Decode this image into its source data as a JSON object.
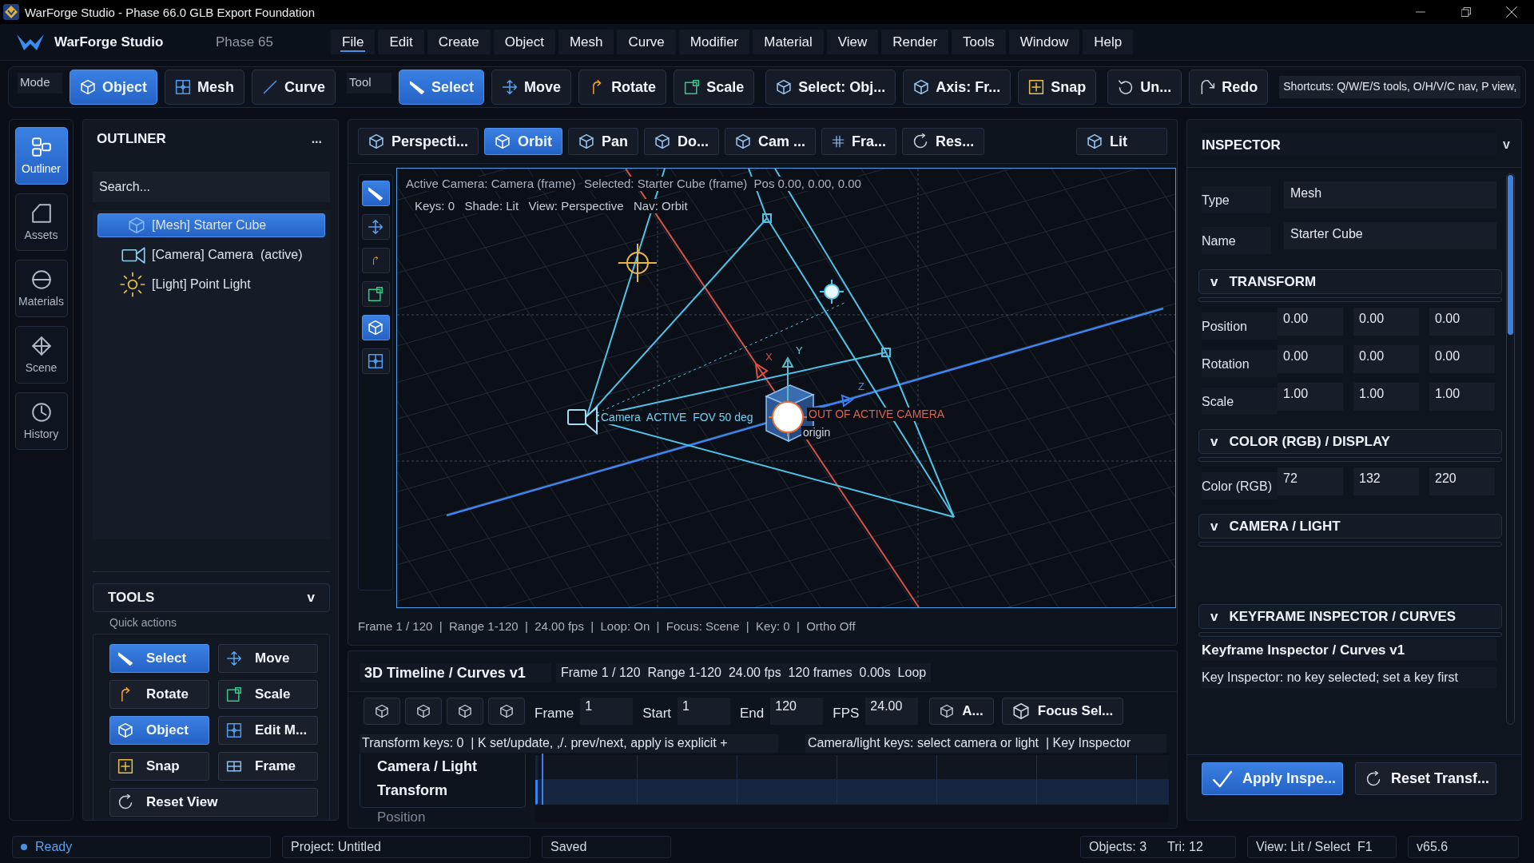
{
  "window": {
    "title": "WarForge Studio - Phase 66.0 GLB Export Foundation"
  },
  "app_bar": {
    "brand": "WarForge Studio",
    "phase": "Phase 65",
    "menus": [
      {
        "label": "File",
        "selected": true
      },
      {
        "label": "Edit",
        "selected": false
      },
      {
        "label": "Create",
        "selected": false
      },
      {
        "label": "Object",
        "selected": false
      },
      {
        "label": "Mesh",
        "selected": false
      },
      {
        "label": "Curve",
        "selected": false
      },
      {
        "label": "Modifier",
        "selected": false
      },
      {
        "label": "Material",
        "selected": false
      },
      {
        "label": "View",
        "selected": false
      },
      {
        "label": "Render",
        "selected": false
      },
      {
        "label": "Tools",
        "selected": false
      },
      {
        "label": "Window",
        "selected": false
      },
      {
        "label": "Help",
        "selected": false
      }
    ]
  },
  "toolbar": {
    "groups": [
      {
        "items": [
          {
            "kind": "label",
            "label": "Mode"
          },
          {
            "kind": "button",
            "label": "Object",
            "selected": true
          },
          {
            "kind": "button",
            "label": "Mesh",
            "selected": false
          },
          {
            "kind": "button",
            "label": "Curve",
            "selected": false
          }
        ]
      },
      {
        "items": [
          {
            "kind": "label",
            "label": "Tool"
          },
          {
            "kind": "button",
            "label": "Select",
            "selected": true
          },
          {
            "kind": "button",
            "label": "Move",
            "selected": false
          },
          {
            "kind": "button",
            "label": "Rotate",
            "selected": false
          },
          {
            "kind": "button",
            "label": "Scale",
            "selected": false
          }
        ]
      },
      {
        "items": [
          {
            "kind": "button",
            "label": "Select: Obj...",
            "selected": false
          },
          {
            "kind": "button",
            "label": "Axis: Fr...",
            "selected": false
          },
          {
            "kind": "button",
            "label": "Snap",
            "selected": false
          }
        ]
      },
      {
        "items": [
          {
            "kind": "button",
            "label": "Un...",
            "selected": false
          },
          {
            "kind": "button",
            "label": "Redo",
            "selected": false
          }
        ]
      }
    ],
    "shortcuts": "Shortcuts: Q/W/E/S tools, O/H/V/C nav, P view,"
  },
  "sidebar": {
    "items": [
      {
        "label": "Outliner",
        "selected": true
      },
      {
        "label": "Assets",
        "selected": false
      },
      {
        "label": "Materials",
        "selected": false
      },
      {
        "label": "Scene",
        "selected": false
      },
      {
        "label": "History",
        "selected": false
      }
    ]
  },
  "outliner": {
    "title": "OUTLINER",
    "menu": "...",
    "search": {
      "placeholder": "Search..."
    },
    "items": [
      {
        "kind": "mesh",
        "label": "[Mesh] Starter Cube",
        "selected": true
      },
      {
        "kind": "camera",
        "label": "[Camera] Camera  (active)",
        "selected": false
      },
      {
        "kind": "light",
        "label": "[Light] Point Light",
        "selected": false
      }
    ]
  },
  "tools": {
    "title": "TOOLS",
    "toggle": "v",
    "subtitle": "Quick actions",
    "buttons": [
      {
        "label": "Select",
        "selected": true
      },
      {
        "label": "Move",
        "selected": false
      },
      {
        "label": "Rotate",
        "selected": false
      },
      {
        "label": "Scale",
        "selected": false
      },
      {
        "label": "Object",
        "selected": true
      },
      {
        "label": "Edit M...",
        "selected": false
      },
      {
        "label": "Snap",
        "selected": false
      },
      {
        "label": "Frame",
        "selected": false
      },
      {
        "label": "Reset View",
        "selected": false
      }
    ]
  },
  "viewport": {
    "toolbar": [
      {
        "label": "Perspecti...",
        "selected": false
      },
      {
        "label": "Orbit",
        "selected": true
      },
      {
        "label": "Pan",
        "selected": false
      },
      {
        "label": "Do...",
        "selected": false
      },
      {
        "label": "Cam ...",
        "selected": false
      },
      {
        "label": "Fra...",
        "selected": false
      },
      {
        "label": "Res...",
        "selected": false
      }
    ],
    "shading": {
      "label": "Lit",
      "selected": false
    },
    "side_tools": [
      {
        "selected": true
      },
      {
        "selected": false
      },
      {
        "selected": false
      },
      {
        "selected": false
      },
      {
        "selected": true
      },
      {
        "selected": false
      }
    ],
    "overlay": {
      "active_camera": "Active Camera: Camera (frame)",
      "selection": "Selected: Starter Cube (frame)  Pos 0.00, 0.00, 0.00",
      "info": "Keys: 0   Shade: Lit   View: Perspective   Nav: Orbit"
    },
    "labels": {
      "camera": "Camera  ACTIVE  FOV 50 deg",
      "warning": "OUT OF ACTIVE CAMERA",
      "origin": "origin",
      "x_axis": "X",
      "y_axis": "Y",
      "z_axis": "Z"
    },
    "status": "Frame 1 / 120  |  Range 1-120  |  24.00 fps  |  Loop: On  |  Focus: Scene  |  Key: 0  |  Ortho Off"
  },
  "timeline": {
    "title": "3D Timeline / Curves v1",
    "summary": "Frame 1 / 120  Range 1-120  24.00 fps  120 frames  0.00s  Loop",
    "fields": [
      {
        "label": "Frame",
        "value": "1"
      },
      {
        "label": "Start",
        "value": "1"
      },
      {
        "label": "End",
        "value": "120"
      },
      {
        "label": "FPS",
        "value": "24.00"
      }
    ],
    "buttons": [
      "A...",
      "Focus Sel..."
    ],
    "info": [
      "Transform keys: 0  | K set/update, ,/. prev/next, apply is explicit +",
      "Camera/light keys: select camera or light  | Key Inspector"
    ],
    "tracks": [
      {
        "label": "Camera / Light",
        "selected": false
      },
      {
        "label": "Transform",
        "selected": true
      }
    ],
    "subtrack": "Position"
  },
  "inspector": {
    "title": "INSPECTOR",
    "toggle": "v",
    "fields": [
      {
        "label": "Type",
        "value": "Mesh"
      },
      {
        "label": "Name",
        "value": "Starter Cube"
      }
    ],
    "sections": [
      {
        "kind": "vectors",
        "toggle": "v",
        "title": "TRANSFORM",
        "rows": [
          {
            "label": "Position",
            "values": [
              "0.00",
              "0.00",
              "0.00"
            ]
          },
          {
            "label": "Rotation",
            "values": [
              "0.00",
              "0.00",
              "0.00"
            ]
          },
          {
            "label": "Scale",
            "values": [
              "1.00",
              "1.00",
              "1.00"
            ]
          }
        ]
      },
      {
        "kind": "vectors",
        "toggle": "v",
        "title": "COLOR (RGB) / DISPLAY",
        "rows": [
          {
            "label": "Color (RGB)",
            "values": [
              "72",
              "132",
              "220"
            ]
          }
        ]
      },
      {
        "kind": "empty",
        "toggle": "v",
        "title": "CAMERA / LIGHT"
      },
      {
        "kind": "notes",
        "toggle": "v",
        "title": "KEYFRAME INSPECTOR / CURVES",
        "heading": "Keyframe Inspector / Curves v1",
        "text": "Key Inspector: no key selected; set a key first"
      }
    ],
    "buttons": [
      {
        "label": "Apply Inspe...",
        "primary": true
      },
      {
        "label": "Reset Transf...",
        "primary": false
      }
    ]
  },
  "status_bar": {
    "state": "Ready",
    "project": "Project: Untitled",
    "save_state": "Saved",
    "objects": "Objects: 3",
    "triangles": "Tri: 12",
    "view": "View: Lit / Select  F1",
    "version": "v65.6"
  }
}
